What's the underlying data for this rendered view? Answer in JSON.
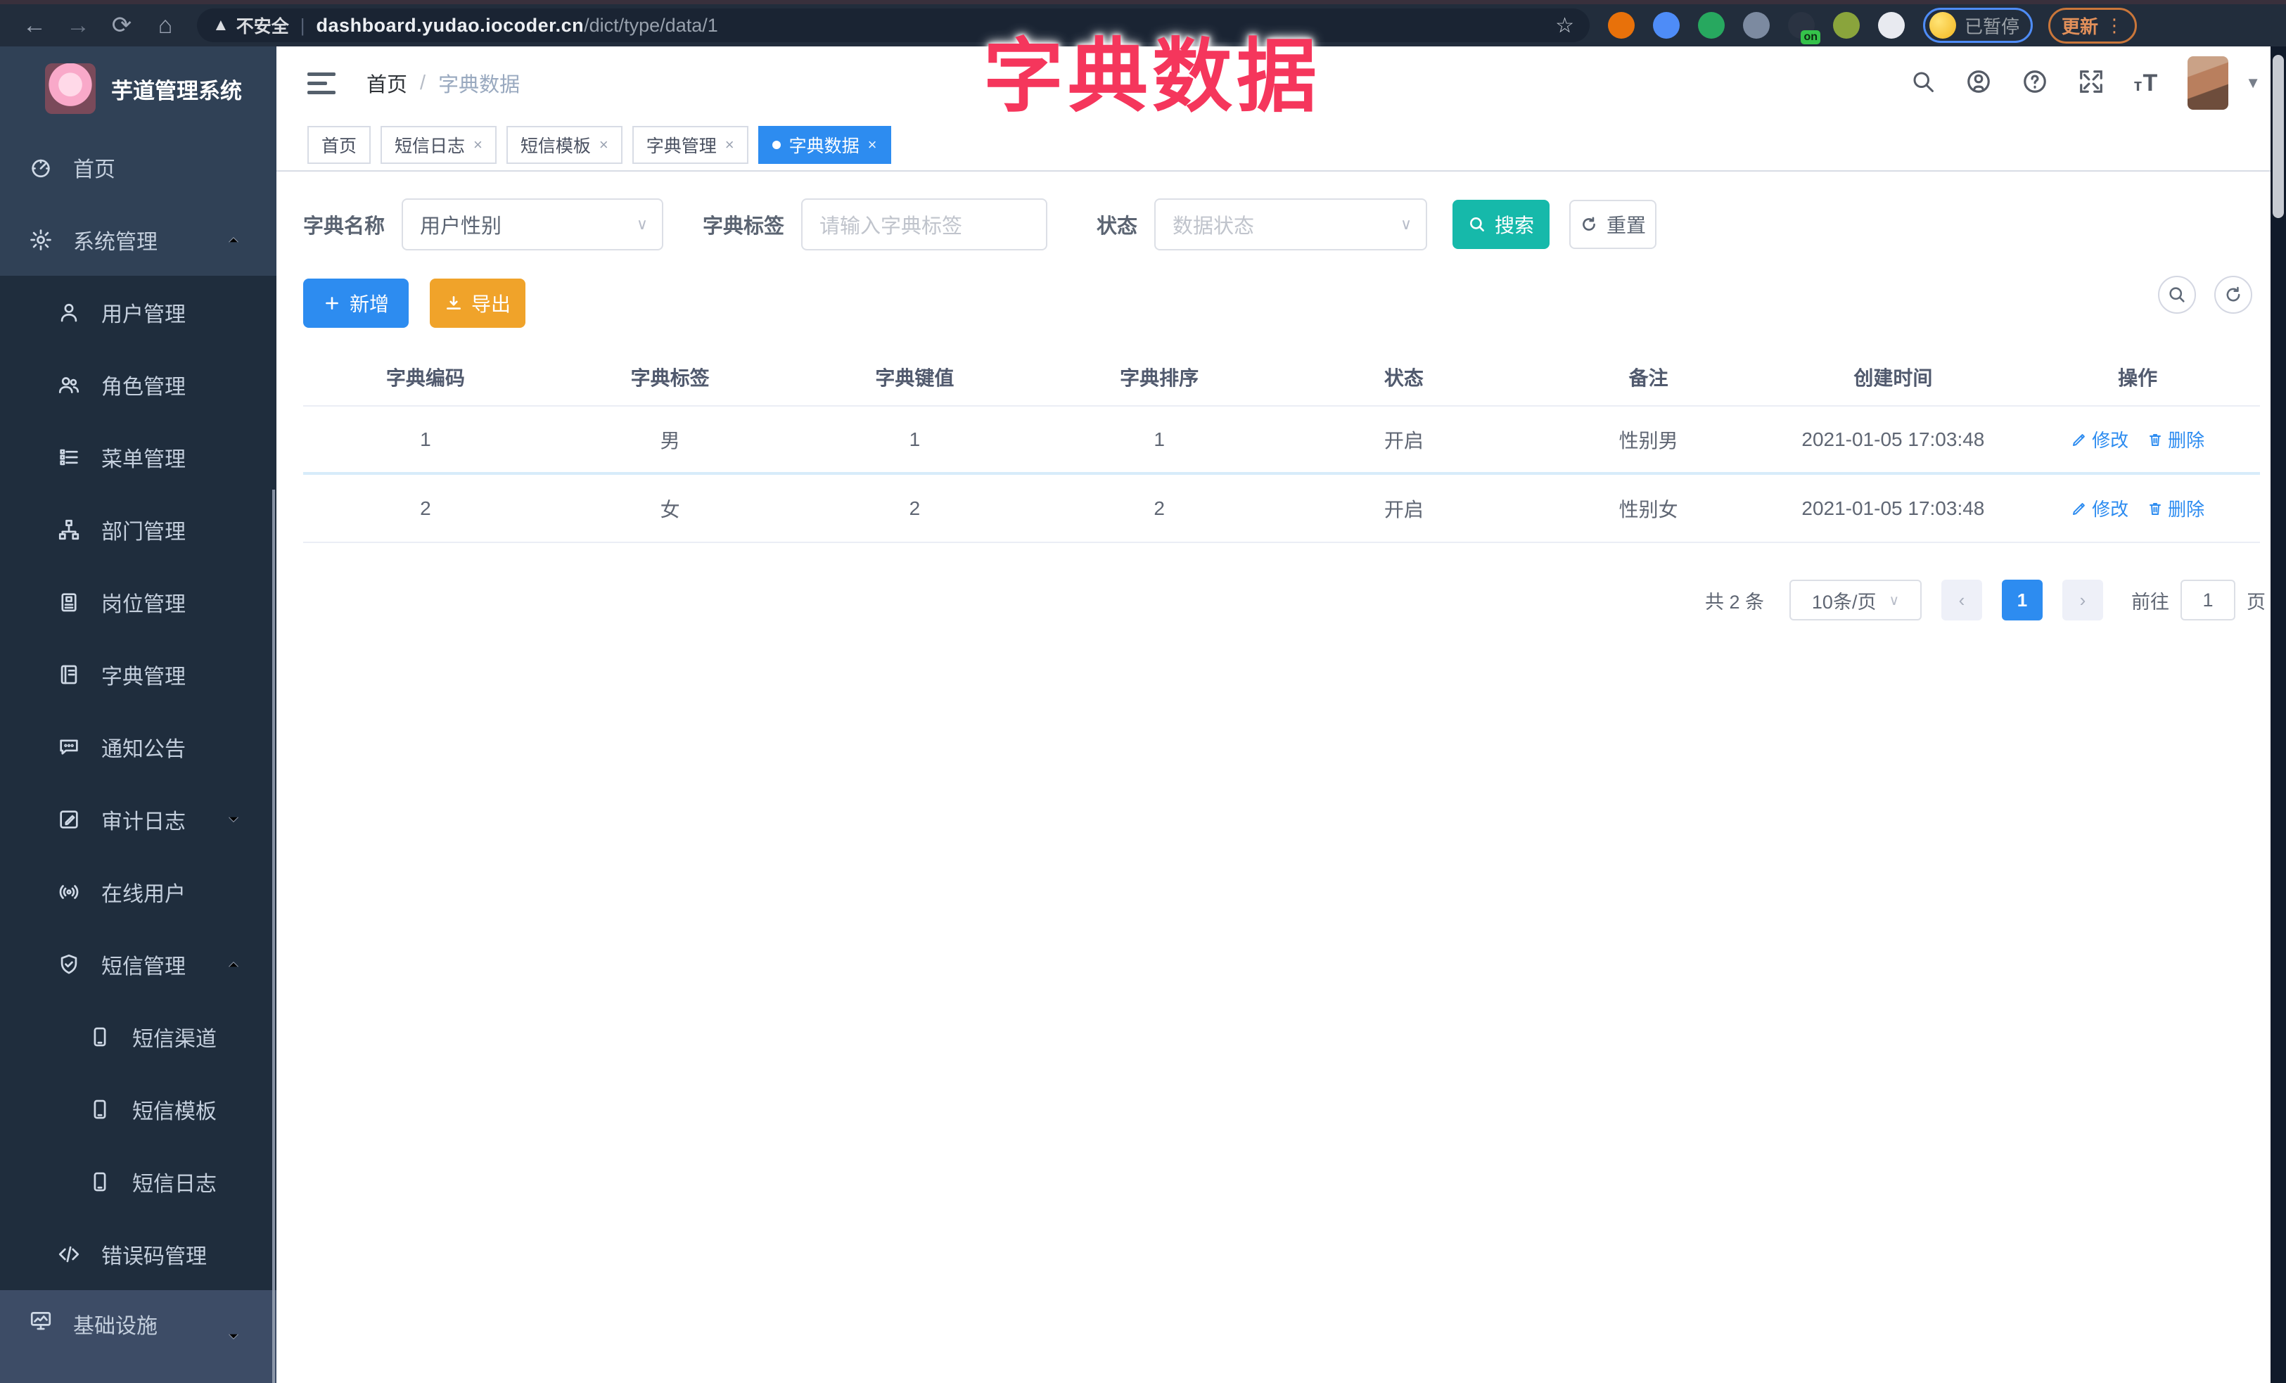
{
  "colors": {
    "accent_blue": "#2d8cf0",
    "teal": "#16b9aa",
    "warning_orange": "#f0a32a",
    "overlay_pink": "#f5365c",
    "sidebar_bg": "#304156",
    "submenu_bg": "#1f2d3d"
  },
  "overlay_title": "字典数据",
  "browser": {
    "security_label": "不安全",
    "url_host": "dashboard.yudao.iocoder.cn",
    "url_path": "/dict/type/data/1",
    "profile_status": "已暂停",
    "update_label": "更新",
    "extensions": [
      {
        "name": "extension-orange-icon",
        "color": "#e8710a"
      },
      {
        "name": "extension-blue-icon",
        "color": "#4e8cf7"
      },
      {
        "name": "extension-green-check-icon",
        "color": "#27a85f"
      },
      {
        "name": "extension-slate-icon",
        "color": "#7c8aa0"
      },
      {
        "name": "extension-dark-icon",
        "color": "#2a3342",
        "badge": "on"
      },
      {
        "name": "extension-olive-icon",
        "color": "#8aa43c"
      },
      {
        "name": "extension-white-icon",
        "color": "#e8eaf0"
      }
    ]
  },
  "sidebar": {
    "app_title": "芋道管理系统",
    "items": [
      {
        "label": "首页",
        "icon": "dashboard-icon",
        "level": 1,
        "section": "base"
      },
      {
        "label": "系统管理",
        "icon": "gear-icon",
        "level": 1,
        "section": "base",
        "chevron": "up"
      },
      {
        "label": "用户管理",
        "icon": "user-icon",
        "level": 2,
        "section": "submenu"
      },
      {
        "label": "角色管理",
        "icon": "users-icon",
        "level": 2,
        "section": "submenu"
      },
      {
        "label": "菜单管理",
        "icon": "menu-list-icon",
        "level": 2,
        "section": "submenu"
      },
      {
        "label": "部门管理",
        "icon": "org-tree-icon",
        "level": 2,
        "section": "submenu"
      },
      {
        "label": "岗位管理",
        "icon": "badge-icon",
        "level": 2,
        "section": "submenu"
      },
      {
        "label": "字典管理",
        "icon": "dictionary-icon",
        "level": 2,
        "section": "submenu"
      },
      {
        "label": "通知公告",
        "icon": "announcement-icon",
        "level": 2,
        "section": "submenu"
      },
      {
        "label": "审计日志",
        "icon": "audit-log-icon",
        "level": 2,
        "section": "submenu",
        "chevron": "down"
      },
      {
        "label": "在线用户",
        "icon": "online-user-icon",
        "level": 2,
        "section": "submenu"
      },
      {
        "label": "短信管理",
        "icon": "shield-check-icon",
        "level": 2,
        "section": "submenu",
        "chevron": "up"
      },
      {
        "label": "短信渠道",
        "icon": "phone-icon",
        "level": 3,
        "section": "submenu"
      },
      {
        "label": "短信模板",
        "icon": "phone-icon",
        "level": 3,
        "section": "submenu"
      },
      {
        "label": "短信日志",
        "icon": "phone-icon",
        "level": 3,
        "section": "submenu"
      },
      {
        "label": "错误码管理",
        "icon": "code-icon",
        "level": 2,
        "section": "submenu"
      },
      {
        "label": "基础设施",
        "icon": "monitor-icon",
        "level": 1,
        "section": "hover",
        "chevron": "down"
      }
    ]
  },
  "header": {
    "breadcrumb_home": "首页",
    "breadcrumb_sep": "/",
    "breadcrumb_current": "字典数据"
  },
  "tabs": [
    {
      "label": "首页",
      "closable": false,
      "active": false
    },
    {
      "label": "短信日志",
      "closable": true,
      "active": false
    },
    {
      "label": "短信模板",
      "closable": true,
      "active": false
    },
    {
      "label": "字典管理",
      "closable": true,
      "active": false
    },
    {
      "label": "字典数据",
      "closable": true,
      "active": true
    }
  ],
  "filters": {
    "dict_name_label": "字典名称",
    "dict_name_value": "用户性别",
    "dict_label_label": "字典标签",
    "dict_label_placeholder": "请输入字典标签",
    "status_label": "状态",
    "status_placeholder": "数据状态",
    "search_label": "搜索",
    "reset_label": "重置"
  },
  "toolbar": {
    "add_label": "新增",
    "export_label": "导出"
  },
  "table": {
    "headers": [
      "字典编码",
      "字典标签",
      "字典键值",
      "字典排序",
      "状态",
      "备注",
      "创建时间",
      "操作"
    ],
    "rows": [
      [
        "1",
        "男",
        "1",
        "1",
        "开启",
        "性别男",
        "2021-01-05 17:03:48"
      ],
      [
        "2",
        "女",
        "2",
        "2",
        "开启",
        "性别女",
        "2021-01-05 17:03:48"
      ]
    ],
    "edit_label": "修改",
    "delete_label": "删除"
  },
  "pagination": {
    "total_text": "共 2 条",
    "page_size": "10条/页",
    "prev": "‹",
    "current_page": "1",
    "next": "›",
    "goto_label": "前往",
    "goto_value": "1",
    "page_unit": "页"
  }
}
